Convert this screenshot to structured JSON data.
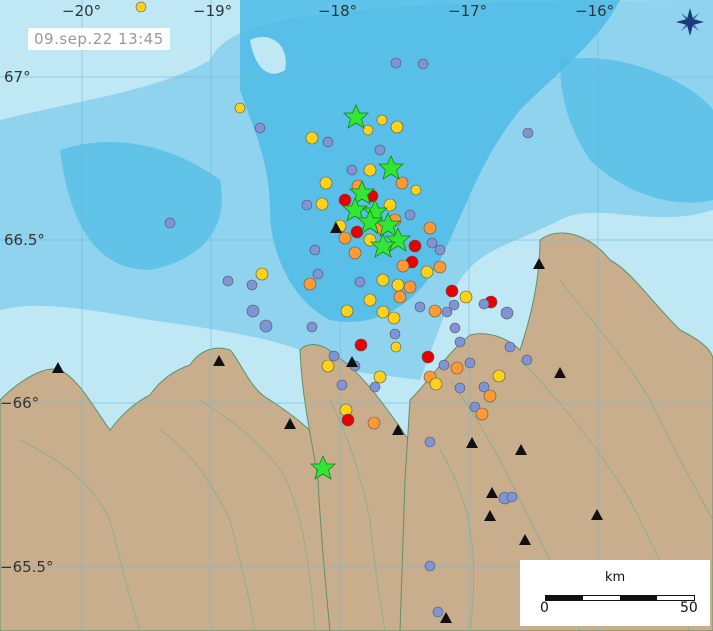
{
  "map": {
    "timestamp": "09.sep.22  13:45",
    "longitude_labels": [
      "−20°",
      "−19°",
      "−18°",
      "−17°",
      "−16°"
    ],
    "latitude_labels": [
      "67°",
      "66.5°",
      "−66°",
      "−65.5°"
    ],
    "scale": {
      "unit": "km",
      "start": "0",
      "end": "50"
    },
    "icons": {
      "compass": "compass-rose-icon",
      "station": "triangle-station-icon",
      "large_quake": "green-star-icon"
    },
    "colors": {
      "sea_deep": "#4fbce6",
      "sea_mid": "#8fd3ef",
      "sea_shallow": "#bfe8f4",
      "land": "#c9ae8e",
      "land_contour": "#7fae8a",
      "quake_red": "#e60000",
      "quake_orange": "#ff9933",
      "quake_yellow": "#ffd21a",
      "quake_blue": "#7f93d6",
      "star_green": "#33e633",
      "station_black": "#111111"
    }
  }
}
